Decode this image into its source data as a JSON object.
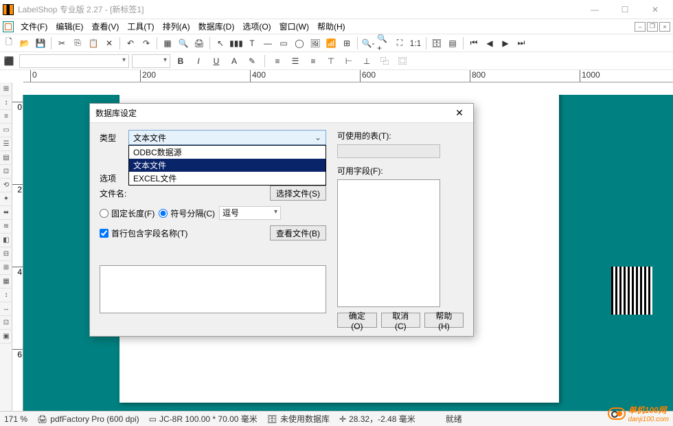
{
  "title": "LabelShop 专业版 2.27 - [新标签1]",
  "menus": [
    "文件(F)",
    "编辑(E)",
    "查看(V)",
    "工具(T)",
    "排列(A)",
    "数据库(D)",
    "选项(O)",
    "窗口(W)",
    "帮助(H)"
  ],
  "rulerH": [
    0,
    200,
    400,
    600,
    800,
    1000
  ],
  "rulerV": [
    0,
    2,
    4,
    6
  ],
  "dialog": {
    "title": "数据库设定",
    "typeLabel": "类型",
    "typeValue": "文本文件",
    "typeOptions": [
      "ODBC数据源",
      "文本文件",
      "EXCEL文件"
    ],
    "optHidden": "选项",
    "fileLabel": "文件名:",
    "selectFileBtn": "选择文件(S)",
    "fixedLen": "固定长度(F)",
    "delim": "符号分隔(C)",
    "delimVal": "逗号",
    "firstRow": "首行包含字段名称(T)",
    "viewFileBtn": "查看文件(B)",
    "tablesLabel": "可使用的表(T):",
    "fieldsLabel": "可用字段(F):",
    "ok": "确定(O)",
    "cancel": "取消(C)",
    "help": "帮助(H)"
  },
  "status": {
    "zoom": "171 %",
    "printer": "pdfFactory Pro (600 dpi)",
    "paper": "JC-8R  100.00 * 70.00 毫米",
    "db": "未使用数据库",
    "coord": "28.32，-2.48 毫米",
    "ready": "就绪"
  },
  "watermark": {
    "t1": "单机100网",
    "t2": "danji100.com"
  }
}
